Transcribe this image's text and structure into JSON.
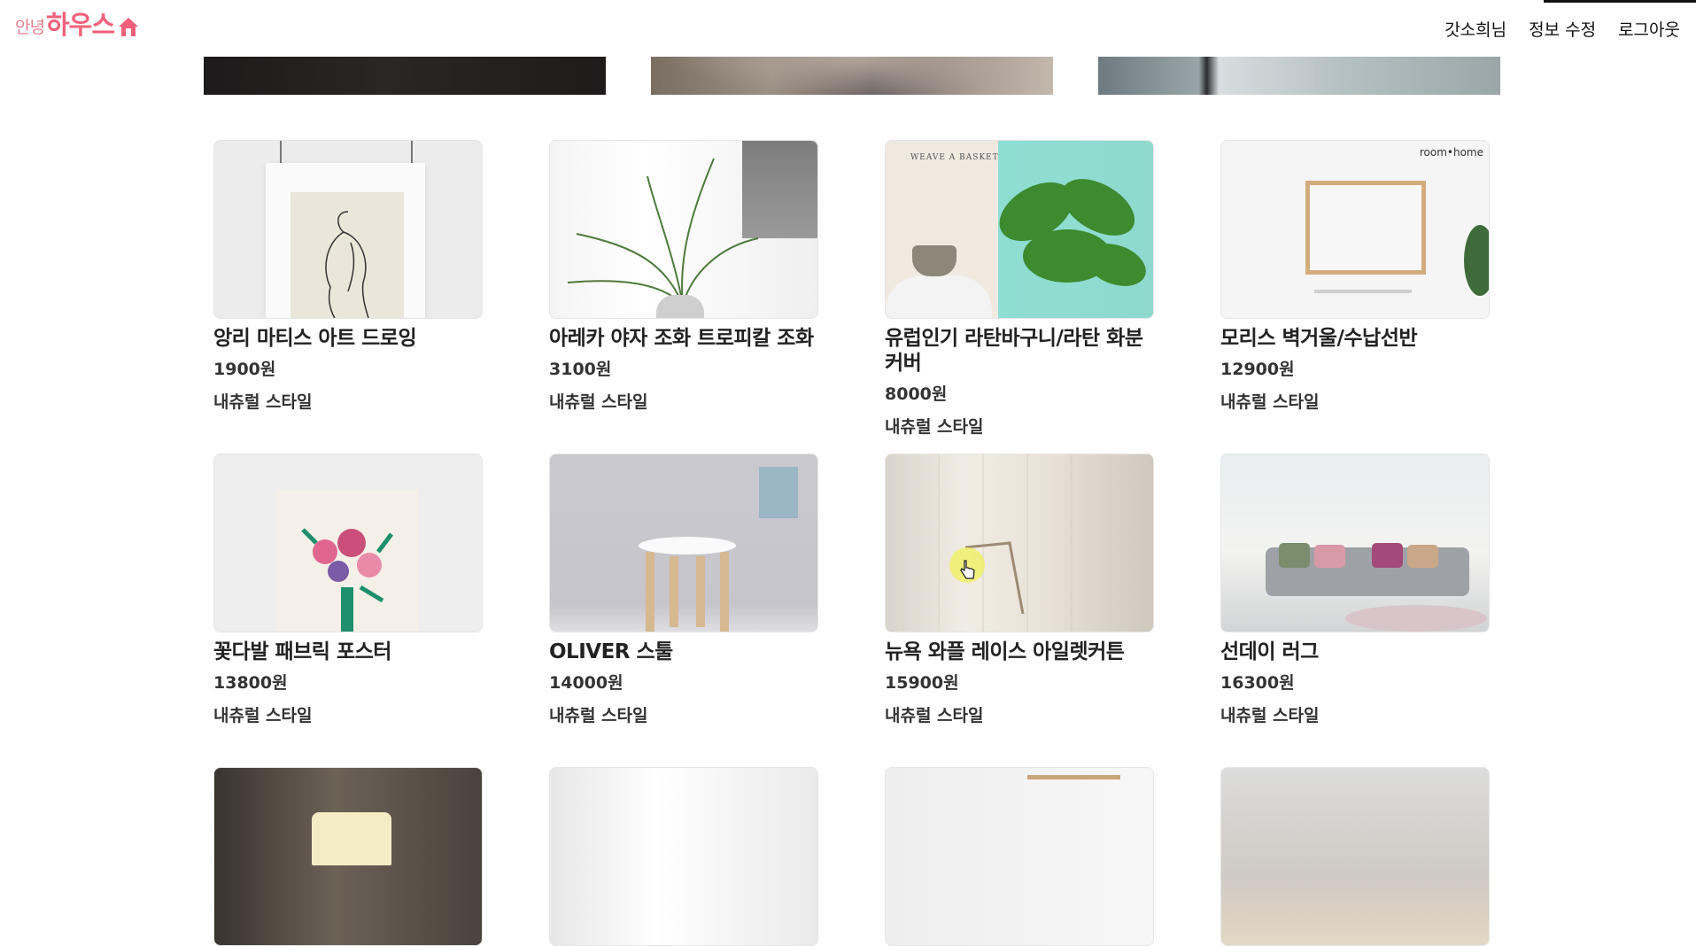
{
  "header": {
    "logo_small": "안녕",
    "logo_big": "하우스",
    "nav": [
      "갓소희님",
      "정보 수정",
      "로그아웃"
    ]
  },
  "products": [
    {
      "name": "앙리 마티스 아트 드로잉",
      "price": "1900원",
      "style": "내츄럴 스타일"
    },
    {
      "name": "아레카 야자 조화 트로피칼 조화",
      "price": "3100원",
      "style": "내츄럴 스타일"
    },
    {
      "name": "유럽인기 라탄바구니/라탄 화분커버",
      "price": "8000원",
      "style": "내츄럴 스타일"
    },
    {
      "name": "모리스 벽거울/수납선반",
      "price": "12900원",
      "style": "내츄럴 스타일"
    },
    {
      "name": "꽃다발 패브릭 포스터",
      "price": "13800원",
      "style": "내츄럴 스타일"
    },
    {
      "name": "OLIVER 스툴",
      "price": "14000원",
      "style": "내츄럴 스타일"
    },
    {
      "name": "뉴욕 와플 레이스 아일렛커튼",
      "price": "15900원",
      "style": "내츄럴 스타일"
    },
    {
      "name": "선데이 러그",
      "price": "16300원",
      "style": "내츄럴 스타일"
    }
  ],
  "thumb_text": {
    "basket_caption": "WEAVE A BASKET",
    "mirror_brand": "room•home"
  },
  "colors": {
    "logo_pink": "#f0607a",
    "text": "#222222",
    "cursor_highlight": "#f0f05a"
  }
}
